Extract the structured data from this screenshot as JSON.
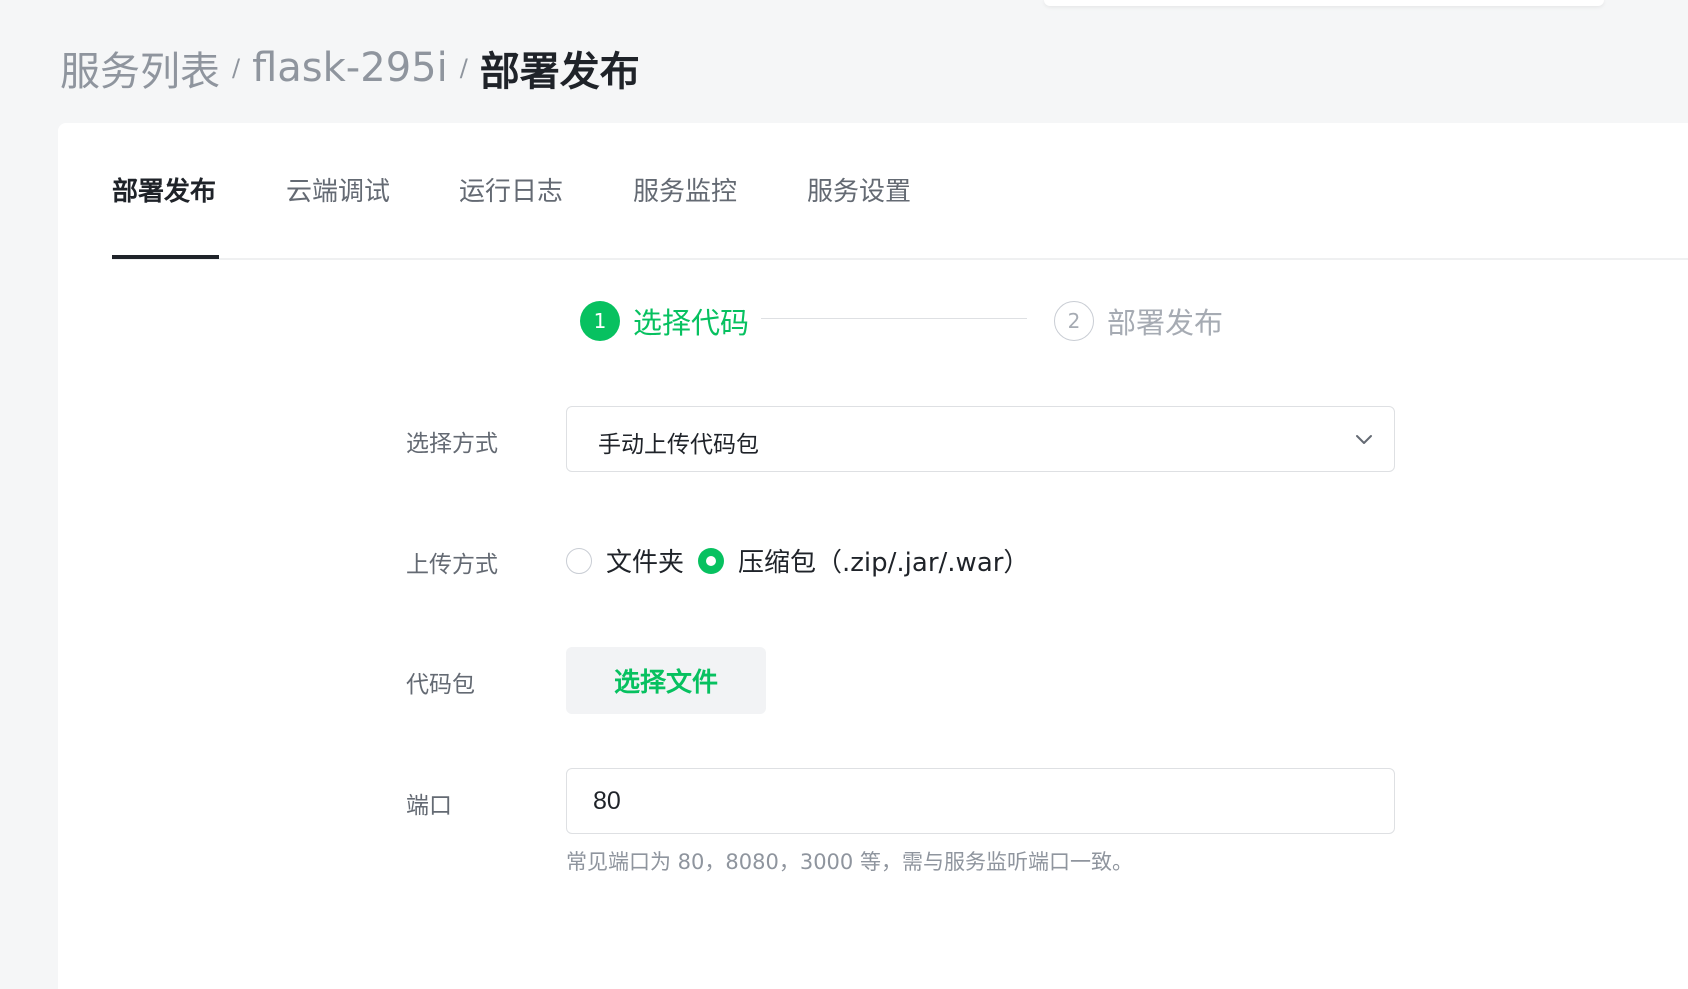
{
  "breadcrumb": {
    "items": [
      "服务列表",
      "flask-295i"
    ],
    "separator": "/",
    "current": "部署发布"
  },
  "tabs": [
    {
      "label": "部署发布",
      "active": true
    },
    {
      "label": "云端调试",
      "active": false
    },
    {
      "label": "运行日志",
      "active": false
    },
    {
      "label": "服务监控",
      "active": false
    },
    {
      "label": "服务设置",
      "active": false
    }
  ],
  "steps": [
    {
      "number": "1",
      "label": "选择代码",
      "state": "active"
    },
    {
      "number": "2",
      "label": "部署发布",
      "state": "pending"
    }
  ],
  "form": {
    "method": {
      "label": "选择方式",
      "value": "手动上传代码包"
    },
    "upload": {
      "label": "上传方式",
      "options": [
        {
          "label": "文件夹",
          "checked": false
        },
        {
          "label": "压缩包（.zip/.jar/.war）",
          "checked": true
        }
      ]
    },
    "package": {
      "label": "代码包",
      "button_label": "选择文件"
    },
    "port": {
      "label": "端口",
      "value": "80",
      "hint": "常见端口为 80，8080，3000 等，需与服务监听端口一致。"
    }
  },
  "colors": {
    "accent": "#07c160",
    "text_primary": "#1f2329",
    "text_secondary": "#646a73",
    "text_muted": "#8f959e",
    "page_background": "#f5f6f7"
  },
  "icons": {
    "select_caret": "chevron-down-icon"
  }
}
